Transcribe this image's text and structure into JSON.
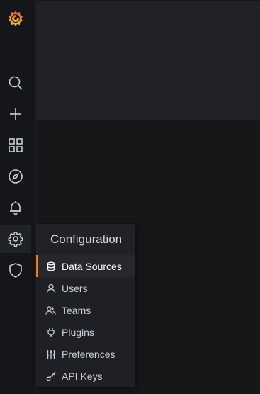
{
  "sidebar": {
    "logo": "grafana-logo",
    "items": [
      {
        "icon": "search-icon"
      },
      {
        "icon": "plus-icon"
      },
      {
        "icon": "dashboards-grid-icon"
      },
      {
        "icon": "compass-icon"
      },
      {
        "icon": "bell-icon"
      },
      {
        "icon": "gear-icon"
      },
      {
        "icon": "shield-icon"
      }
    ]
  },
  "flyout": {
    "title": "Configuration",
    "items": [
      {
        "label": "Data Sources",
        "icon": "database-icon"
      },
      {
        "label": "Users",
        "icon": "user-icon"
      },
      {
        "label": "Teams",
        "icon": "users-icon"
      },
      {
        "label": "Plugins",
        "icon": "plug-icon"
      },
      {
        "label": "Preferences",
        "icon": "sliders-icon"
      },
      {
        "label": "API Keys",
        "icon": "key-icon"
      }
    ]
  },
  "colors": {
    "accent": "#f27b19",
    "sidebar_bg": "#141619",
    "panel_bg": "#212226",
    "text": "#c7d0d9"
  }
}
